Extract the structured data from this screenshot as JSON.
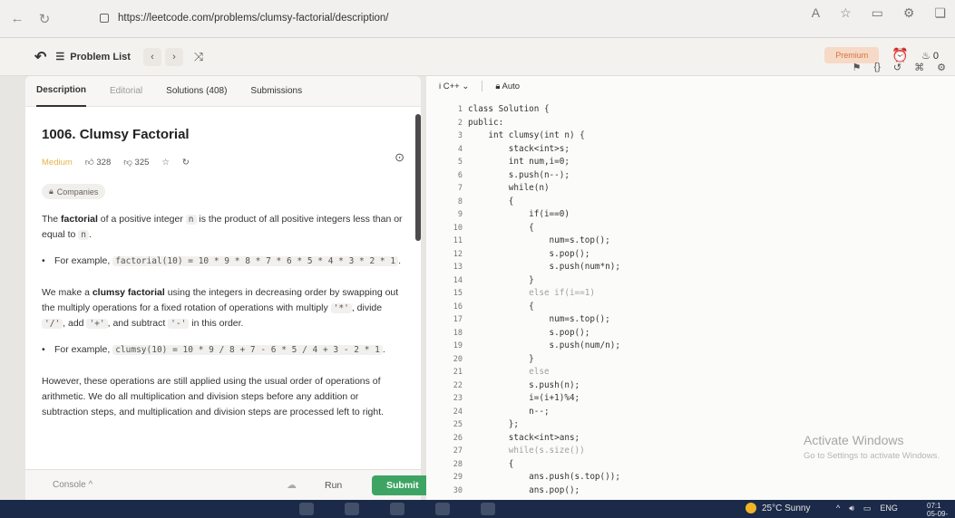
{
  "browser": {
    "url": "https://leetcode.com/problems/clumsy-factorial/description/"
  },
  "nav": {
    "problem_list_label": "Problem List",
    "premium_label": "Premium",
    "streak_count": "0"
  },
  "tabs": [
    {
      "label": "Description"
    },
    {
      "label": "Editorial"
    },
    {
      "label": "Solutions (408)"
    },
    {
      "label": "Submissions"
    }
  ],
  "problem": {
    "title": "1006. Clumsy Factorial",
    "difficulty": "Medium",
    "likes": "328",
    "dislikes": "325",
    "companies_label": "Companies",
    "para1_prefix": "The ",
    "para1_bold": "factorial",
    "para1_rest": " of a positive integer ",
    "para1_code": "n",
    "para1_tail": " is the product of all positive integers less than or equal to ",
    "para1_code2": "n",
    "para1_end": ".",
    "bullet1_prefix": "For example, ",
    "bullet1_code": "factorial(10) = 10 * 9 * 8 * 7 * 6 * 5 * 4 * 3 * 2 * 1",
    "bullet1_end": ".",
    "para2_prefix": "We make a ",
    "para2_bold": "clumsy factorial",
    "para2_rest": " using the integers in decreasing order by swapping out the multiply operations for a fixed rotation of operations with multiply ",
    "op_multiply": "'*'",
    "para2_divide": ", divide ",
    "op_divide": "'/'",
    "para2_add": ", add ",
    "op_add": "'+'",
    "para2_sub": ", and subtract ",
    "op_sub": "'-'",
    "para2_end": " in this order.",
    "bullet2_prefix": "For example, ",
    "bullet2_code": "clumsy(10) = 10 * 9 / 8 + 7 - 6 * 5 / 4 + 3 - 2 * 1",
    "bullet2_end": ".",
    "para3": "However, these operations are still applied using the usual order of operations of arithmetic. We do all multiplication and division steps before any addition or subtraction steps, and multiplication and division steps are processed left to right."
  },
  "bottom": {
    "console_label": "Console ^",
    "run_label": "Run",
    "submit_label": "Submit"
  },
  "editor": {
    "language": "C++",
    "mode": "Auto",
    "lines": [
      {
        "n": "1",
        "code": "class Solution {"
      },
      {
        "n": "2",
        "code": "public:"
      },
      {
        "n": "3",
        "code": "    int clumsy(int n) {"
      },
      {
        "n": "4",
        "code": "        stack<int>s;"
      },
      {
        "n": "5",
        "code": "        int num,i=0;"
      },
      {
        "n": "6",
        "code": "        s.push(n--);"
      },
      {
        "n": "7",
        "code": "        while(n)"
      },
      {
        "n": "8",
        "code": "        {"
      },
      {
        "n": "9",
        "code": "            if(i==0)"
      },
      {
        "n": "10",
        "code": "            {"
      },
      {
        "n": "11",
        "code": "                num=s.top();"
      },
      {
        "n": "12",
        "code": "                s.pop();"
      },
      {
        "n": "13",
        "code": "                s.push(num*n);"
      },
      {
        "n": "14",
        "code": "            }"
      },
      {
        "n": "15",
        "code": "            else if(i==1)"
      },
      {
        "n": "16",
        "code": "            {"
      },
      {
        "n": "17",
        "code": "                num=s.top();"
      },
      {
        "n": "18",
        "code": "                s.pop();"
      },
      {
        "n": "19",
        "code": "                s.push(num/n);"
      },
      {
        "n": "20",
        "code": "            }"
      },
      {
        "n": "21",
        "code": "            else"
      },
      {
        "n": "22",
        "code": "            s.push(n);"
      },
      {
        "n": "23",
        "code": "            i=(i+1)%4;"
      },
      {
        "n": "24",
        "code": "            n--;"
      },
      {
        "n": "25",
        "code": "        };"
      },
      {
        "n": "26",
        "code": "        stack<int>ans;"
      },
      {
        "n": "27",
        "code": "        while(s.size())"
      },
      {
        "n": "28",
        "code": "        {"
      },
      {
        "n": "29",
        "code": "            ans.push(s.top());"
      },
      {
        "n": "30",
        "code": "            ans.pop();"
      }
    ]
  },
  "watermark": {
    "line1": "Activate Windows",
    "line2": "Go to Settings to activate Windows."
  },
  "taskbar": {
    "weather": "25°C  Sunny",
    "lang": "ENG",
    "time": "07:1",
    "date": "05-09-"
  }
}
